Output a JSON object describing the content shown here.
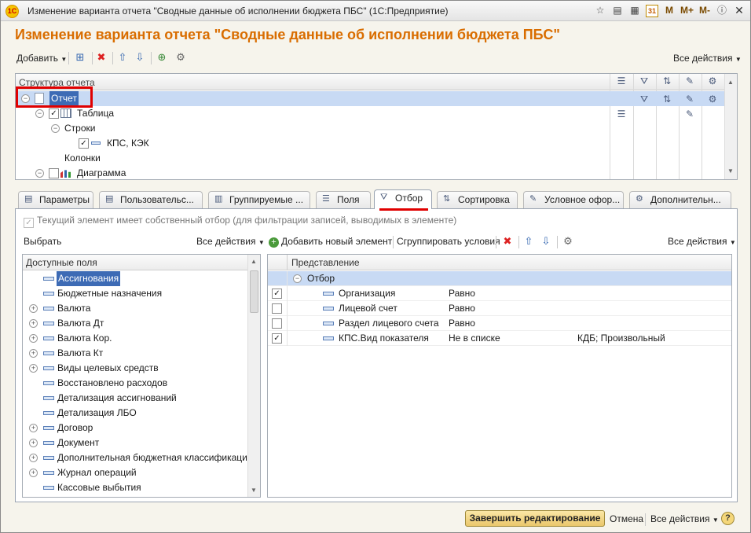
{
  "window": {
    "title": "Изменение варианта отчета \"Сводные данные об исполнении бюджета ПБС\" (1С:Предприятие)",
    "logo_text": "1С",
    "mem_buttons": [
      "M",
      "M+",
      "M-"
    ]
  },
  "form": {
    "title": "Изменение варианта отчета \"Сводные данные об исполнении бюджета ПБС\""
  },
  "toolbar": {
    "add_label": "Добавить",
    "all_actions_label": "Все действия"
  },
  "structure": {
    "header_title": "Структура отчета",
    "rows": [
      {
        "label": "Отчет"
      },
      {
        "label": "Таблица"
      },
      {
        "label": "Строки"
      },
      {
        "label": "КПС, КЭК"
      },
      {
        "label": "Колонки"
      },
      {
        "label": "Диаграмма"
      }
    ]
  },
  "tabs": [
    {
      "label": "Параметры"
    },
    {
      "label": "Пользовательс..."
    },
    {
      "label": "Группируемые ..."
    },
    {
      "label": "Поля"
    },
    {
      "label": "Отбор"
    },
    {
      "label": "Сортировка"
    },
    {
      "label": "Условное офор..."
    },
    {
      "label": "Дополнительн..."
    }
  ],
  "filter_tab": {
    "own_filter_label": "Текущий элемент имеет собственный отбор (для фильтрации записей, выводимых в элементе)",
    "select_label": "Выбрать",
    "left_all_actions": "Все действия",
    "add_new_element": "Добавить новый элемент",
    "group_conditions": "Сгруппировать условия",
    "right_all_actions": "Все действия",
    "available_fields_header": "Доступные поля",
    "available_fields": [
      {
        "label": "Ассигнования",
        "expandable": false
      },
      {
        "label": "Бюджетные назначения",
        "expandable": false
      },
      {
        "label": "Валюта",
        "expandable": true
      },
      {
        "label": "Валюта Дт",
        "expandable": true
      },
      {
        "label": "Валюта Кор.",
        "expandable": true
      },
      {
        "label": "Валюта Кт",
        "expandable": true
      },
      {
        "label": "Виды целевых средств",
        "expandable": true
      },
      {
        "label": "Восстановлено расходов",
        "expandable": false
      },
      {
        "label": "Детализация ассигнований",
        "expandable": false
      },
      {
        "label": "Детализация ЛБО",
        "expandable": false
      },
      {
        "label": "Договор",
        "expandable": true
      },
      {
        "label": "Документ",
        "expandable": true
      },
      {
        "label": "Дополнительная бюджетная классификация",
        "expandable": true
      },
      {
        "label": "Журнал операций",
        "expandable": true
      },
      {
        "label": "Кассовые выбытия",
        "expandable": false
      }
    ],
    "filter_header": "Представление",
    "filter_group_label": "Отбор",
    "filter_rows": [
      {
        "checked": true,
        "name": "Организация",
        "condition": "Равно",
        "value": ""
      },
      {
        "checked": false,
        "name": "Лицевой счет",
        "condition": "Равно",
        "value": ""
      },
      {
        "checked": false,
        "name": "Раздел лицевого счета",
        "condition": "Равно",
        "value": ""
      },
      {
        "checked": true,
        "name": "КПС.Вид показателя",
        "condition": "Не в списке",
        "value": "КДБ; Произвольный"
      }
    ]
  },
  "footer": {
    "finish_label": "Завершить редактирование",
    "cancel_label": "Отмена",
    "all_actions_label": "Все действия",
    "help_label": "?"
  },
  "colors": {
    "title_orange": "#d96d00",
    "selection_blue": "#c8daf4",
    "highlight_blue": "#3d6bb5",
    "annotation_red": "#e00000"
  }
}
